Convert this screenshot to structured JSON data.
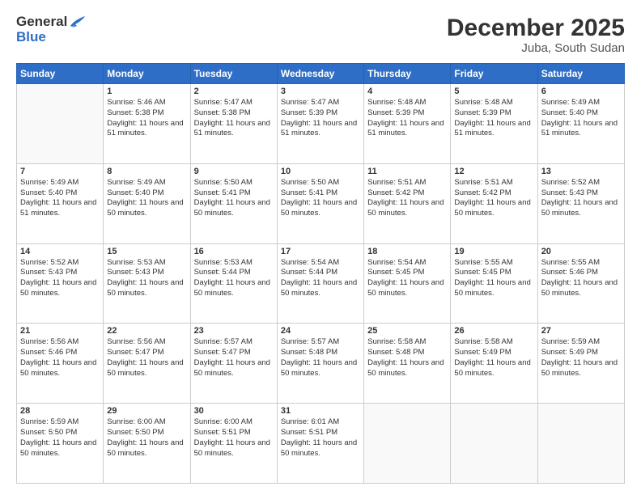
{
  "header": {
    "logo_general": "General",
    "logo_blue": "Blue",
    "title": "December 2025",
    "subtitle": "Juba, South Sudan"
  },
  "days_of_week": [
    "Sunday",
    "Monday",
    "Tuesday",
    "Wednesday",
    "Thursday",
    "Friday",
    "Saturday"
  ],
  "weeks": [
    [
      {
        "day": "",
        "sunrise": "",
        "sunset": "",
        "daylight": ""
      },
      {
        "day": "1",
        "sunrise": "Sunrise: 5:46 AM",
        "sunset": "Sunset: 5:38 PM",
        "daylight": "Daylight: 11 hours and 51 minutes."
      },
      {
        "day": "2",
        "sunrise": "Sunrise: 5:47 AM",
        "sunset": "Sunset: 5:38 PM",
        "daylight": "Daylight: 11 hours and 51 minutes."
      },
      {
        "day": "3",
        "sunrise": "Sunrise: 5:47 AM",
        "sunset": "Sunset: 5:39 PM",
        "daylight": "Daylight: 11 hours and 51 minutes."
      },
      {
        "day": "4",
        "sunrise": "Sunrise: 5:48 AM",
        "sunset": "Sunset: 5:39 PM",
        "daylight": "Daylight: 11 hours and 51 minutes."
      },
      {
        "day": "5",
        "sunrise": "Sunrise: 5:48 AM",
        "sunset": "Sunset: 5:39 PM",
        "daylight": "Daylight: 11 hours and 51 minutes."
      },
      {
        "day": "6",
        "sunrise": "Sunrise: 5:49 AM",
        "sunset": "Sunset: 5:40 PM",
        "daylight": "Daylight: 11 hours and 51 minutes."
      }
    ],
    [
      {
        "day": "7",
        "sunrise": "Sunrise: 5:49 AM",
        "sunset": "Sunset: 5:40 PM",
        "daylight": "Daylight: 11 hours and 51 minutes."
      },
      {
        "day": "8",
        "sunrise": "Sunrise: 5:49 AM",
        "sunset": "Sunset: 5:40 PM",
        "daylight": "Daylight: 11 hours and 50 minutes."
      },
      {
        "day": "9",
        "sunrise": "Sunrise: 5:50 AM",
        "sunset": "Sunset: 5:41 PM",
        "daylight": "Daylight: 11 hours and 50 minutes."
      },
      {
        "day": "10",
        "sunrise": "Sunrise: 5:50 AM",
        "sunset": "Sunset: 5:41 PM",
        "daylight": "Daylight: 11 hours and 50 minutes."
      },
      {
        "day": "11",
        "sunrise": "Sunrise: 5:51 AM",
        "sunset": "Sunset: 5:42 PM",
        "daylight": "Daylight: 11 hours and 50 minutes."
      },
      {
        "day": "12",
        "sunrise": "Sunrise: 5:51 AM",
        "sunset": "Sunset: 5:42 PM",
        "daylight": "Daylight: 11 hours and 50 minutes."
      },
      {
        "day": "13",
        "sunrise": "Sunrise: 5:52 AM",
        "sunset": "Sunset: 5:43 PM",
        "daylight": "Daylight: 11 hours and 50 minutes."
      }
    ],
    [
      {
        "day": "14",
        "sunrise": "Sunrise: 5:52 AM",
        "sunset": "Sunset: 5:43 PM",
        "daylight": "Daylight: 11 hours and 50 minutes."
      },
      {
        "day": "15",
        "sunrise": "Sunrise: 5:53 AM",
        "sunset": "Sunset: 5:43 PM",
        "daylight": "Daylight: 11 hours and 50 minutes."
      },
      {
        "day": "16",
        "sunrise": "Sunrise: 5:53 AM",
        "sunset": "Sunset: 5:44 PM",
        "daylight": "Daylight: 11 hours and 50 minutes."
      },
      {
        "day": "17",
        "sunrise": "Sunrise: 5:54 AM",
        "sunset": "Sunset: 5:44 PM",
        "daylight": "Daylight: 11 hours and 50 minutes."
      },
      {
        "day": "18",
        "sunrise": "Sunrise: 5:54 AM",
        "sunset": "Sunset: 5:45 PM",
        "daylight": "Daylight: 11 hours and 50 minutes."
      },
      {
        "day": "19",
        "sunrise": "Sunrise: 5:55 AM",
        "sunset": "Sunset: 5:45 PM",
        "daylight": "Daylight: 11 hours and 50 minutes."
      },
      {
        "day": "20",
        "sunrise": "Sunrise: 5:55 AM",
        "sunset": "Sunset: 5:46 PM",
        "daylight": "Daylight: 11 hours and 50 minutes."
      }
    ],
    [
      {
        "day": "21",
        "sunrise": "Sunrise: 5:56 AM",
        "sunset": "Sunset: 5:46 PM",
        "daylight": "Daylight: 11 hours and 50 minutes."
      },
      {
        "day": "22",
        "sunrise": "Sunrise: 5:56 AM",
        "sunset": "Sunset: 5:47 PM",
        "daylight": "Daylight: 11 hours and 50 minutes."
      },
      {
        "day": "23",
        "sunrise": "Sunrise: 5:57 AM",
        "sunset": "Sunset: 5:47 PM",
        "daylight": "Daylight: 11 hours and 50 minutes."
      },
      {
        "day": "24",
        "sunrise": "Sunrise: 5:57 AM",
        "sunset": "Sunset: 5:48 PM",
        "daylight": "Daylight: 11 hours and 50 minutes."
      },
      {
        "day": "25",
        "sunrise": "Sunrise: 5:58 AM",
        "sunset": "Sunset: 5:48 PM",
        "daylight": "Daylight: 11 hours and 50 minutes."
      },
      {
        "day": "26",
        "sunrise": "Sunrise: 5:58 AM",
        "sunset": "Sunset: 5:49 PM",
        "daylight": "Daylight: 11 hours and 50 minutes."
      },
      {
        "day": "27",
        "sunrise": "Sunrise: 5:59 AM",
        "sunset": "Sunset: 5:49 PM",
        "daylight": "Daylight: 11 hours and 50 minutes."
      }
    ],
    [
      {
        "day": "28",
        "sunrise": "Sunrise: 5:59 AM",
        "sunset": "Sunset: 5:50 PM",
        "daylight": "Daylight: 11 hours and 50 minutes."
      },
      {
        "day": "29",
        "sunrise": "Sunrise: 6:00 AM",
        "sunset": "Sunset: 5:50 PM",
        "daylight": "Daylight: 11 hours and 50 minutes."
      },
      {
        "day": "30",
        "sunrise": "Sunrise: 6:00 AM",
        "sunset": "Sunset: 5:51 PM",
        "daylight": "Daylight: 11 hours and 50 minutes."
      },
      {
        "day": "31",
        "sunrise": "Sunrise: 6:01 AM",
        "sunset": "Sunset: 5:51 PM",
        "daylight": "Daylight: 11 hours and 50 minutes."
      },
      {
        "day": "",
        "sunrise": "",
        "sunset": "",
        "daylight": ""
      },
      {
        "day": "",
        "sunrise": "",
        "sunset": "",
        "daylight": ""
      },
      {
        "day": "",
        "sunrise": "",
        "sunset": "",
        "daylight": ""
      }
    ]
  ]
}
